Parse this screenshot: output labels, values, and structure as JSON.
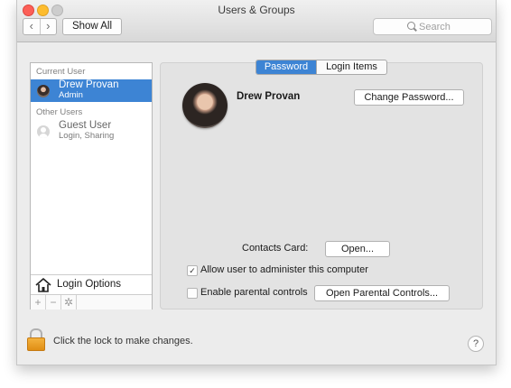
{
  "window": {
    "title": "Users & Groups",
    "back_glyph": "‹",
    "forward_glyph": "›",
    "show_all_label": "Show All",
    "search_placeholder": "Search"
  },
  "sidebar": {
    "current_user_label": "Current User",
    "current_user": {
      "name": "Drew Provan",
      "role": "Admin",
      "avatar": "user-photo-avatar"
    },
    "other_users_label": "Other Users",
    "other_users": [
      {
        "name": "Guest User",
        "role": "Login, Sharing",
        "avatar": "generic-person-avatar"
      }
    ],
    "login_options_label": "Login Options",
    "login_options_icon": "house-icon",
    "add_glyph": "+",
    "remove_glyph": "−",
    "action_glyph": "✲"
  },
  "main": {
    "tabs": [
      {
        "label": "Password",
        "active": true
      },
      {
        "label": "Login Items",
        "active": false
      }
    ],
    "user_full_name": "Drew Provan",
    "change_password_label": "Change Password...",
    "contacts_card_label": "Contacts Card:",
    "open_label": "Open...",
    "allow_admin": {
      "label": "Allow user to administer this computer",
      "checked": true,
      "check_glyph": "✓"
    },
    "parental": {
      "label": "Enable parental controls",
      "checked": false
    },
    "open_parental_label": "Open Parental Controls..."
  },
  "footer": {
    "lock_text": "Click the lock to make changes.",
    "lock_icon": "padlock-icon",
    "help_glyph": "?"
  },
  "colors": {
    "selection_blue": "#3d84d4",
    "lock_orange": "#f0a632",
    "close_red": "#fc5f57",
    "minimize_yellow": "#fdbc2e"
  }
}
